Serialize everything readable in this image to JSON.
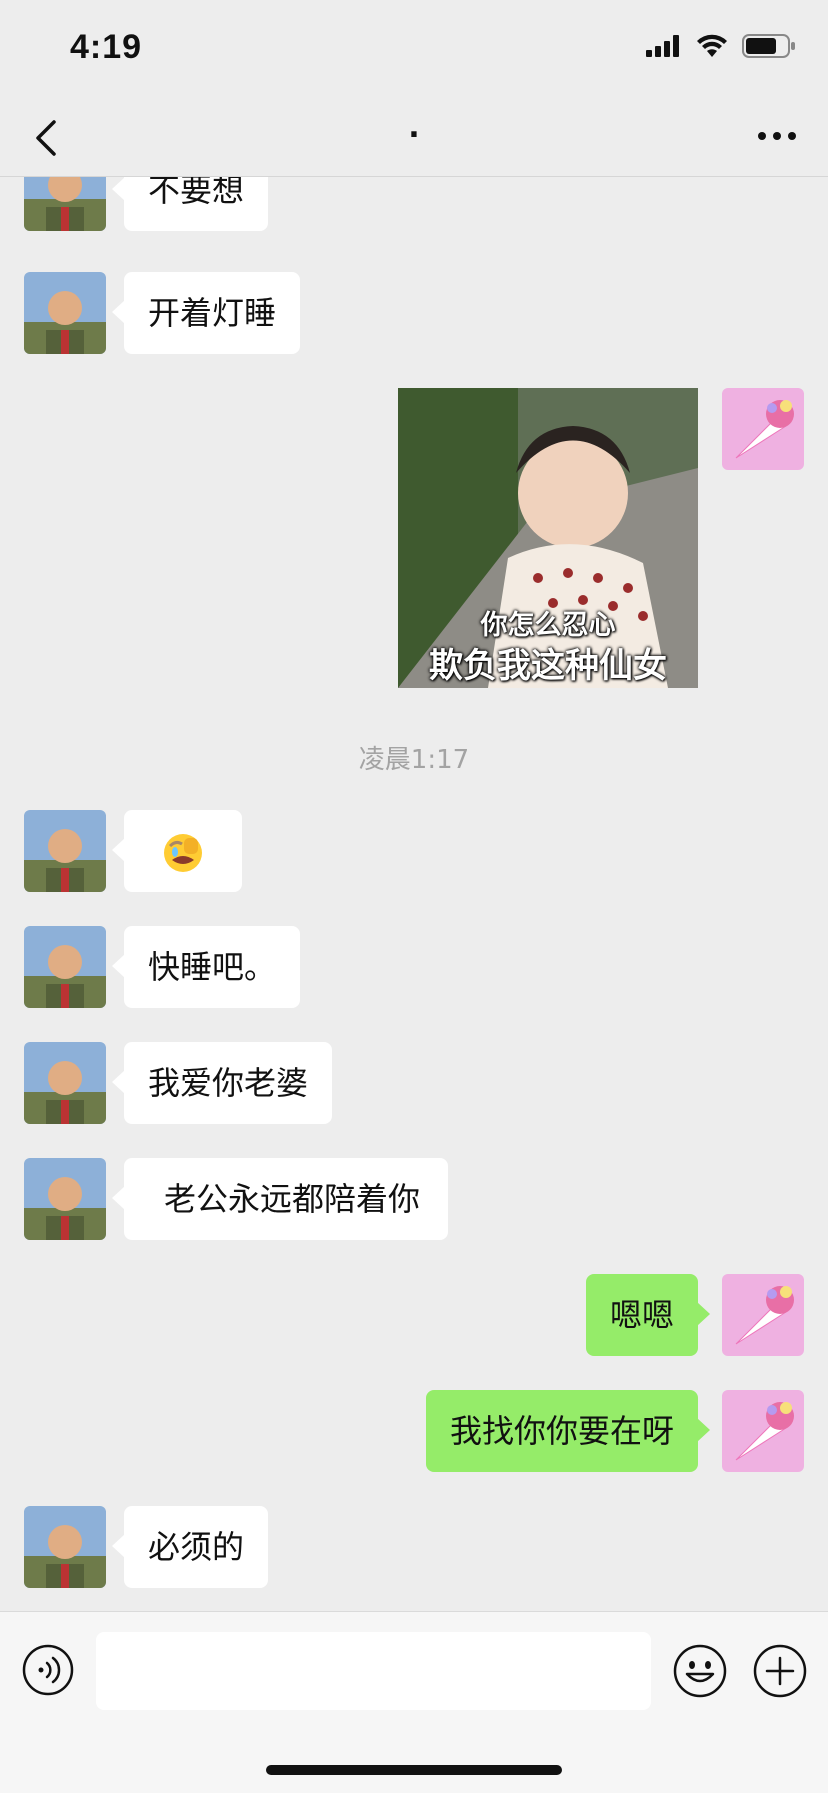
{
  "status_bar": {
    "time": "4:19",
    "icons": [
      "signal-icon",
      "wifi-icon",
      "battery-icon"
    ]
  },
  "nav": {
    "title": ".",
    "back_icon": "chevron-left-icon",
    "more_icon": "ellipsis-icon"
  },
  "messages": [
    {
      "from": "them",
      "text": "不要想"
    },
    {
      "from": "them",
      "text": "开着灯睡"
    },
    {
      "from": "me",
      "type": "sticker",
      "caption_line1": "你怎么忍心",
      "caption_line2": "欺负我这种仙女"
    },
    {
      "type": "time",
      "text": "凌晨1:17"
    },
    {
      "from": "them",
      "type": "emoji",
      "text": "😭"
    },
    {
      "from": "them",
      "text": "快睡吧。"
    },
    {
      "from": "them",
      "text": "我爱你老婆"
    },
    {
      "from": "them",
      "text": "老公永远都陪着你"
    },
    {
      "from": "me",
      "text": "嗯嗯"
    },
    {
      "from": "me",
      "text": "我找你你要在呀"
    },
    {
      "from": "them",
      "text": "必须的"
    }
  ],
  "input_bar": {
    "voice_icon": "voice-icon",
    "text_value": "",
    "emoji_icon": "emoji-icon",
    "plus_icon": "plus-icon"
  },
  "colors": {
    "background": "#ededed",
    "bubble_in": "#ffffff",
    "bubble_out": "#95ec69",
    "timestamp": "#a3a3a3"
  }
}
